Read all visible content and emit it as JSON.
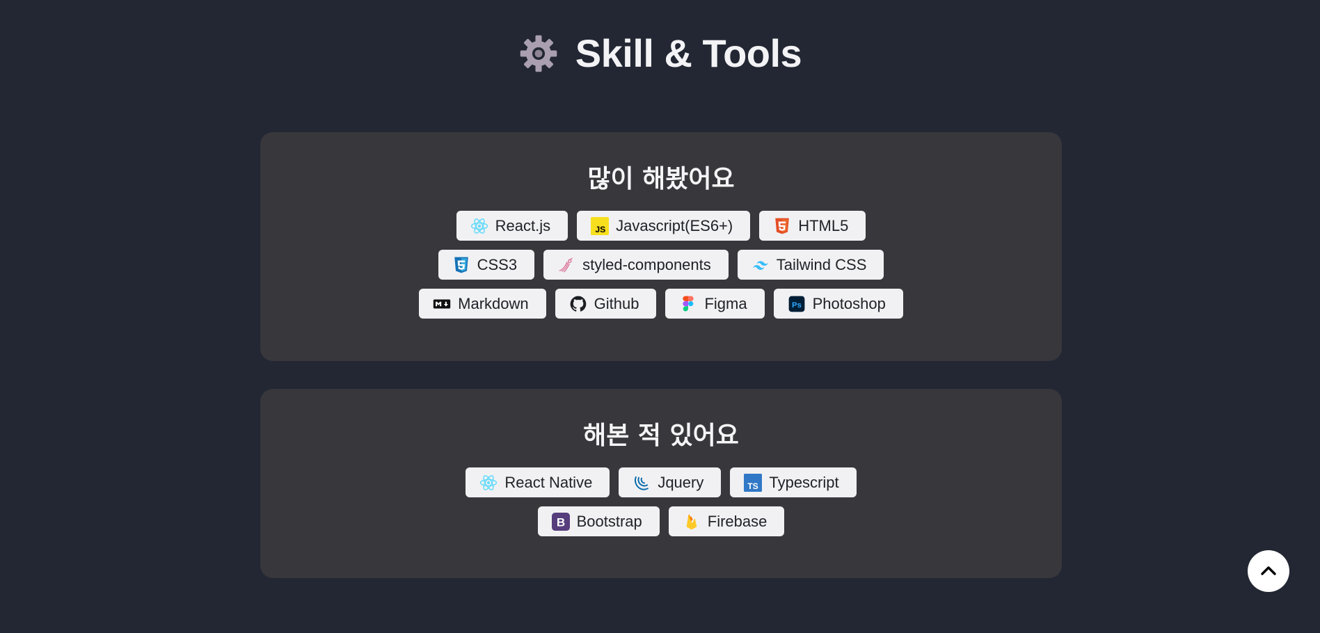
{
  "header": {
    "title": "Skill & Tools",
    "icon": "gear-icon"
  },
  "sections": [
    {
      "heading": "많이 해봤어요",
      "rows": [
        [
          {
            "label": "React.js",
            "icon": "react-icon"
          },
          {
            "label": "Javascript(ES6+)",
            "icon": "javascript-icon"
          },
          {
            "label": "HTML5",
            "icon": "html5-icon"
          }
        ],
        [
          {
            "label": "CSS3",
            "icon": "css3-icon"
          },
          {
            "label": "styled-components",
            "icon": "styled-components-icon"
          },
          {
            "label": "Tailwind CSS",
            "icon": "tailwind-icon"
          }
        ],
        [
          {
            "label": "Markdown",
            "icon": "markdown-icon"
          },
          {
            "label": "Github",
            "icon": "github-icon"
          },
          {
            "label": "Figma",
            "icon": "figma-icon"
          },
          {
            "label": "Photoshop",
            "icon": "photoshop-icon"
          }
        ]
      ]
    },
    {
      "heading": "해본 적 있어요",
      "rows": [
        [
          {
            "label": "React Native",
            "icon": "react-icon"
          },
          {
            "label": "Jquery",
            "icon": "jquery-icon"
          },
          {
            "label": "Typescript",
            "icon": "typescript-icon"
          }
        ],
        [
          {
            "label": "Bootstrap",
            "icon": "bootstrap-icon"
          },
          {
            "label": "Firebase",
            "icon": "firebase-icon"
          }
        ]
      ]
    }
  ],
  "scroll_top": {
    "icon": "chevron-up-icon"
  },
  "colors": {
    "background": "#222733",
    "card": "#37373c",
    "tag": "#f1f1f3",
    "react": "#61dafb",
    "javascript": "#f7df1e",
    "html5": "#e34f26",
    "css3": "#1572b6",
    "tailwind": "#38bdf8",
    "typescript": "#3178c6",
    "bootstrap": "#563d7c",
    "firebase": "#ffca28"
  }
}
